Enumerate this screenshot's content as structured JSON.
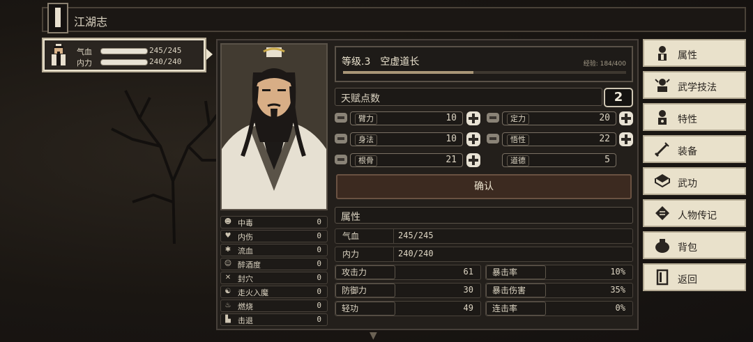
{
  "header": {
    "title": "江湖志",
    "book_glyph": "书"
  },
  "character": {
    "hp_label": "气血",
    "hp_value": "245/245",
    "mp_label": "内力",
    "mp_value": "240/240"
  },
  "status_effects": [
    {
      "icon": "☻",
      "label": "中毒",
      "value": "0"
    },
    {
      "icon": "♥",
      "label": "内伤",
      "value": "0"
    },
    {
      "icon": "✱",
      "label": "流血",
      "value": "0"
    },
    {
      "icon": "☺",
      "label": "醉酒度",
      "value": "0"
    },
    {
      "icon": "✕",
      "label": "封穴",
      "value": "0"
    },
    {
      "icon": "☯",
      "label": "走火入魔",
      "value": "0"
    },
    {
      "icon": "♨",
      "label": "燃烧",
      "value": "0"
    },
    {
      "icon": "▙",
      "label": "击退",
      "value": "0"
    }
  ],
  "level": {
    "text": "等级.3　空虚道长",
    "exp_text": "经验: 184/400",
    "exp_fraction": 0.46
  },
  "talent": {
    "label": "天赋点数",
    "value": "2"
  },
  "attributes": {
    "strength": {
      "label": "臂力",
      "value": "10"
    },
    "focus": {
      "label": "定力",
      "value": "20"
    },
    "agility": {
      "label": "身法",
      "value": "10"
    },
    "insight": {
      "label": "悟性",
      "value": "22"
    },
    "bone": {
      "label": "根骨",
      "value": "21"
    },
    "morality": {
      "label": "道德",
      "value": "5"
    }
  },
  "confirm_label": "确认",
  "properties": {
    "title": "属性",
    "hp": {
      "label": "气血",
      "value": "245/245"
    },
    "mp": {
      "label": "内力",
      "value": "240/240"
    },
    "attack": {
      "label": "攻击力",
      "value": "61"
    },
    "crit_rate": {
      "label": "暴击率",
      "value": "10%"
    },
    "defense": {
      "label": "防御力",
      "value": "30"
    },
    "crit_dmg": {
      "label": "暴击伤害",
      "value": "35%"
    },
    "lightness": {
      "label": "轻功",
      "value": "49"
    },
    "combo": {
      "label": "连击率",
      "value": "0%"
    }
  },
  "menu": [
    {
      "label": "属性",
      "icon": "character-icon"
    },
    {
      "label": "武学技法",
      "icon": "martial-skill-icon"
    },
    {
      "label": "特性",
      "icon": "trait-icon"
    },
    {
      "label": "装备",
      "icon": "sword-icon"
    },
    {
      "label": "武功",
      "icon": "book-icon"
    },
    {
      "label": "人物传记",
      "icon": "biography-icon"
    },
    {
      "label": "背包",
      "icon": "bag-icon"
    },
    {
      "label": "返回",
      "icon": "door-icon"
    }
  ],
  "colors": {
    "panel": "#231f1b",
    "menu_button": "#e9e1cb",
    "confirm": "#3c2a20"
  }
}
